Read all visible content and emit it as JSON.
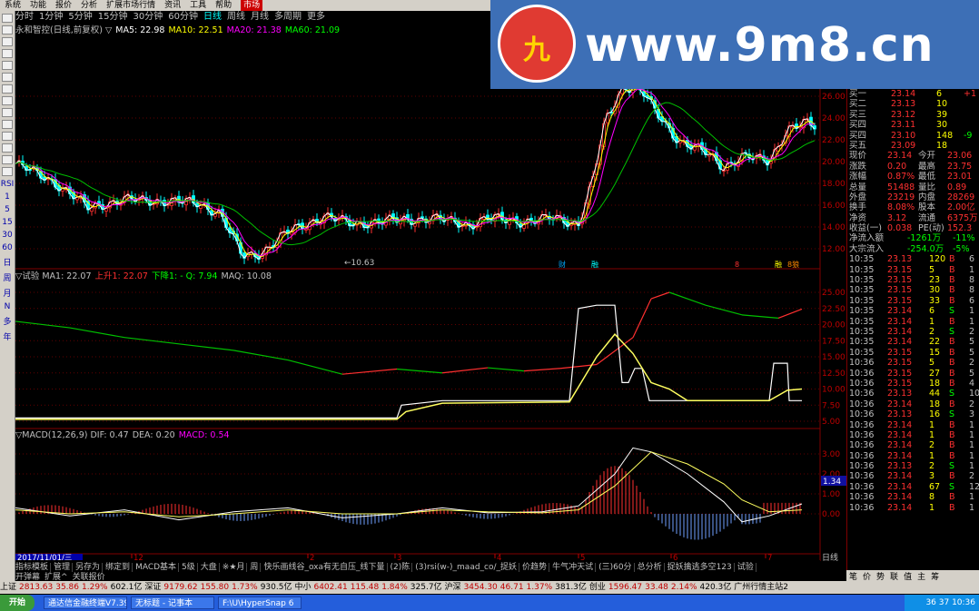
{
  "menubar": {
    "items": [
      "系统",
      "功能",
      "报价",
      "分析",
      "扩展市场行情",
      "资讯",
      "工具",
      "帮助"
    ],
    "market_label": "市场"
  },
  "period_bar": {
    "items": [
      "分时",
      "1分钟",
      "5分钟",
      "15分钟",
      "30分钟",
      "60分钟",
      "日线",
      "周线",
      "月线",
      "多周期",
      "更多"
    ],
    "active": "日线"
  },
  "left_toolbar": {
    "labels": [
      "RSI",
      "1",
      "5",
      "15",
      "30",
      "60",
      "日",
      "周",
      "月",
      "N",
      "多",
      "年"
    ]
  },
  "logo": {
    "text": "www.9m8.cn",
    "emblem": "九"
  },
  "main_chart": {
    "title": "永和智控(日线,前复权)",
    "ma": [
      {
        "label": "MA5: 22.98",
        "color": "#ffffff"
      },
      {
        "label": "MA10: 22.51",
        "color": "#ffff00"
      },
      {
        "label": "MA20: 21.38",
        "color": "#ff00ff"
      },
      {
        "label": "MA60: 21.09",
        "color": "#00ff00"
      }
    ],
    "y_ticks": [
      "26.00",
      "24.00",
      "22.00",
      "20.00",
      "18.00",
      "16.00",
      "14.00",
      "12.00"
    ],
    "low_label": "10.63",
    "markers": [
      "财",
      "融",
      "8",
      "融",
      "8狼"
    ]
  },
  "indicator1": {
    "header": [
      {
        "text": "▽试验 MA1: 22.07",
        "color": "#c0c0c0"
      },
      {
        "text": "上升1: 22.07",
        "color": "#ff3030"
      },
      {
        "text": "下降1: - Q: 7.94",
        "color": "#00ff00"
      },
      {
        "text": "MAQ: 10.08",
        "color": "#c0c0c0"
      }
    ],
    "y_ticks": [
      "25.00",
      "22.50",
      "20.00",
      "17.50",
      "15.00",
      "12.50",
      "10.00",
      "7.50",
      "5.00"
    ]
  },
  "macd": {
    "header": [
      {
        "text": "▽MACD(12,26,9) DIF: 0.47",
        "color": "#c0c0c0"
      },
      {
        "text": "DEA: 0.20",
        "color": "#c0c0c0"
      },
      {
        "text": "MACD: 0.54",
        "color": "#ff00ff"
      }
    ],
    "y_ticks": [
      "3.00",
      "2.00",
      "1.00",
      "0.00"
    ],
    "cursor_value": "1.34"
  },
  "x_axis": {
    "date_label": "2017/11/01/三",
    "months": [
      "12",
      "2",
      "3",
      "4",
      "5",
      "6",
      "7"
    ],
    "right_label": "日线"
  },
  "bottom_tabs": [
    "指标模板",
    "管理",
    "另存为",
    "绑定到",
    "MACD基本",
    "5级",
    "大盘",
    "※★月",
    "周",
    "快乐画线谷_oxa有无自压_线下量",
    "(2)陈",
    "(3)rsi(w-)_maad_co/_捉妖",
    "价趋势",
    "牛气冲天试",
    "(三)60分",
    "总分析",
    "捉妖擒逃多空123",
    "试验"
  ],
  "bottom_tabs2": [
    "开弹幕",
    "扩展^",
    "关联报价"
  ],
  "quote": {
    "buy": [
      {
        "l": "买一",
        "p": "23.14",
        "v": "6",
        "c": "+1"
      },
      {
        "l": "买二",
        "p": "23.13",
        "v": "10",
        "c": ""
      },
      {
        "l": "买三",
        "p": "23.12",
        "v": "39",
        "c": ""
      },
      {
        "l": "买四",
        "p": "23.11",
        "v": "30",
        "c": ""
      },
      {
        "l": "买四",
        "p": "23.10",
        "v": "148",
        "c": "-9"
      },
      {
        "l": "买五",
        "p": "23.09",
        "v": "18",
        "c": ""
      }
    ],
    "stats": [
      [
        "现价",
        "23.14",
        "今开",
        "23.06"
      ],
      [
        "涨跌",
        "0.20",
        "最高",
        "23.75"
      ],
      [
        "涨幅",
        "0.87%",
        "最低",
        "23.01"
      ],
      [
        "总量",
        "51488",
        "量比",
        "0.89"
      ],
      [
        "外盘",
        "23219",
        "内盘",
        "28269"
      ],
      [
        "换手",
        "8.08%",
        "股本",
        "2.00亿"
      ],
      [
        "净资",
        "3.12",
        "流通",
        "6375万"
      ],
      [
        "收益(一)",
        "0.038",
        "PE(动)",
        "152.3"
      ]
    ],
    "flow": [
      [
        "净流入额",
        "-1261万",
        "-11%"
      ],
      [
        "大宗流入",
        "-254.0万",
        "-5%"
      ]
    ],
    "ticks": [
      [
        "10:35",
        "23.13",
        "120",
        "B",
        "6"
      ],
      [
        "10:35",
        "23.15",
        "5",
        "B",
        "1"
      ],
      [
        "10:35",
        "23.15",
        "23",
        "B",
        "8"
      ],
      [
        "10:35",
        "23.15",
        "30",
        "B",
        "8"
      ],
      [
        "10:35",
        "23.15",
        "33",
        "B",
        "6"
      ],
      [
        "10:35",
        "23.14",
        "6",
        "S",
        "1"
      ],
      [
        "10:35",
        "23.14",
        "1",
        "B",
        "1"
      ],
      [
        "10:35",
        "23.14",
        "2",
        "S",
        "2"
      ],
      [
        "10:35",
        "23.14",
        "22",
        "B",
        "5"
      ],
      [
        "10:35",
        "23.15",
        "15",
        "B",
        "5"
      ],
      [
        "10:36",
        "23.15",
        "5",
        "B",
        "2"
      ],
      [
        "10:36",
        "23.15",
        "27",
        "B",
        "5"
      ],
      [
        "10:36",
        "23.15",
        "18",
        "B",
        "4"
      ],
      [
        "10:36",
        "23.13",
        "44",
        "S",
        "10"
      ],
      [
        "10:36",
        "23.14",
        "18",
        "B",
        "2"
      ],
      [
        "10:36",
        "23.13",
        "16",
        "S",
        "3"
      ],
      [
        "10:36",
        "23.14",
        "1",
        "B",
        "1"
      ],
      [
        "10:36",
        "23.14",
        "1",
        "B",
        "1"
      ],
      [
        "10:36",
        "23.14",
        "2",
        "B",
        "1"
      ],
      [
        "10:36",
        "23.14",
        "1",
        "B",
        "1"
      ],
      [
        "10:36",
        "23.13",
        "2",
        "S",
        "1"
      ],
      [
        "10:36",
        "23.14",
        "3",
        "B",
        "2"
      ],
      [
        "10:36",
        "23.14",
        "67",
        "S",
        "12"
      ],
      [
        "10:36",
        "23.14",
        "8",
        "B",
        "1"
      ],
      [
        "10:36",
        "23.14",
        "1",
        "B",
        "1"
      ]
    ],
    "tabs": [
      "笔",
      "价",
      "势",
      "联",
      "值",
      "主",
      "筹"
    ]
  },
  "statusbar": {
    "segments": [
      {
        "t": "上证",
        "c": "#000"
      },
      {
        "t": "2813.63",
        "c": "#c00000"
      },
      {
        "t": "35.86",
        "c": "#c00000"
      },
      {
        "t": "1.29%",
        "c": "#c00000"
      },
      {
        "t": "602.1亿",
        "c": "#000"
      },
      {
        "t": "深证",
        "c": "#000"
      },
      {
        "t": "9179.62",
        "c": "#c00000"
      },
      {
        "t": "155.80",
        "c": "#c00000"
      },
      {
        "t": "1.73%",
        "c": "#c00000"
      },
      {
        "t": "930.5亿",
        "c": "#000"
      },
      {
        "t": "中小",
        "c": "#000"
      },
      {
        "t": "6402.41",
        "c": "#c00000"
      },
      {
        "t": "115.48",
        "c": "#c00000"
      },
      {
        "t": "1.84%",
        "c": "#c00000"
      },
      {
        "t": "325.7亿",
        "c": "#000"
      },
      {
        "t": "沪深",
        "c": "#000"
      },
      {
        "t": "3454.30",
        "c": "#c00000"
      },
      {
        "t": "46.71",
        "c": "#c00000"
      },
      {
        "t": "1.37%",
        "c": "#c00000"
      },
      {
        "t": "381.3亿",
        "c": "#000"
      },
      {
        "t": "创业",
        "c": "#000"
      },
      {
        "t": "1596.47",
        "c": "#c00000"
      },
      {
        "t": "33.48",
        "c": "#c00000"
      },
      {
        "t": "2.14%",
        "c": "#c00000"
      },
      {
        "t": "420.3亿",
        "c": "#000"
      },
      {
        "t": "广州行情主站2",
        "c": "#000"
      }
    ]
  },
  "taskbar": {
    "start": "开始",
    "tasks": [
      "通达信金融终端V7.39 -...",
      "无标题 - 记事本",
      "F:\\U\\HyperSnap 6"
    ],
    "tray": "36 37  10:36"
  }
}
